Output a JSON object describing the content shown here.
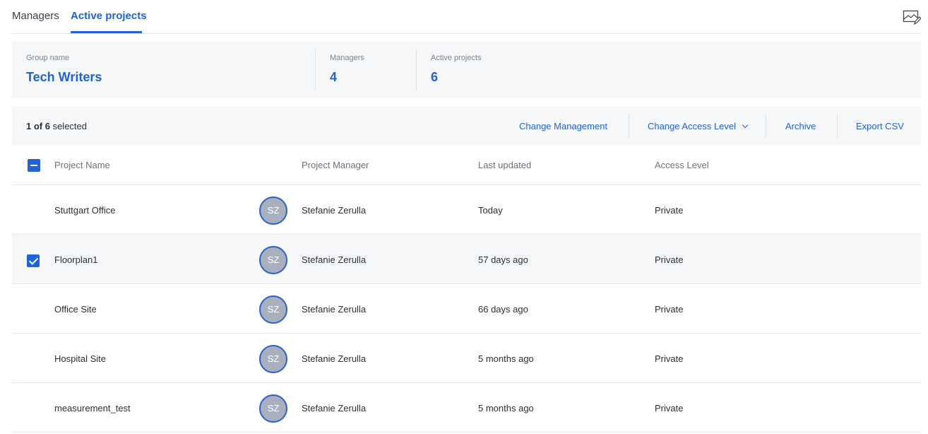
{
  "tabs": [
    {
      "label": "Managers",
      "active": false
    },
    {
      "label": "Active projects",
      "active": true
    }
  ],
  "summary": {
    "group_label": "Group name",
    "group_value": "Tech Writers",
    "managers_label": "Managers",
    "managers_value": "4",
    "projects_label": "Active projects",
    "projects_value": "6"
  },
  "selection": {
    "count": "1 of 6",
    "suffix": " selected"
  },
  "actions": {
    "change_management": "Change Management",
    "change_access": "Change Access Level",
    "archive": "Archive",
    "export": "Export CSV"
  },
  "table": {
    "headers": {
      "name": "Project Name",
      "manager": "Project Manager",
      "updated": "Last updated",
      "access": "Access Level"
    },
    "rows": [
      {
        "name": "Stuttgart Office",
        "initials": "SZ",
        "manager": "Stefanie Zerulla",
        "updated": "Today",
        "access": "Private",
        "selected": false
      },
      {
        "name": "Floorplan1",
        "initials": "SZ",
        "manager": "Stefanie Zerulla",
        "updated": "57 days ago",
        "access": "Private",
        "selected": true
      },
      {
        "name": "Office Site",
        "initials": "SZ",
        "manager": "Stefanie Zerulla",
        "updated": "66 days ago",
        "access": "Private",
        "selected": false
      },
      {
        "name": "Hospital Site",
        "initials": "SZ",
        "manager": "Stefanie Zerulla",
        "updated": "5 months ago",
        "access": "Private",
        "selected": false
      },
      {
        "name": "measurement_test",
        "initials": "SZ",
        "manager": "Stefanie Zerulla",
        "updated": "5 months ago",
        "access": "Private",
        "selected": false
      }
    ]
  },
  "colors": {
    "accent": "#1f63d8",
    "panel": "#f6f7f9",
    "avatar": "#a9b0bd"
  },
  "icons": {
    "edit": "edit-image-icon",
    "dropdown": "chevron-down-icon"
  }
}
